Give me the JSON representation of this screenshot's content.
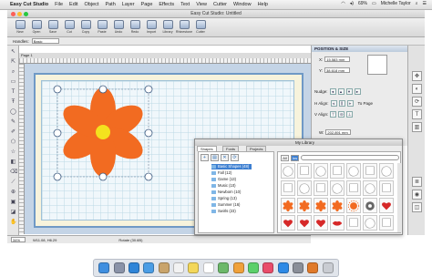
{
  "menubar": {
    "app_name": "Easy Cut Studio",
    "menus": [
      "File",
      "Edit",
      "Object",
      "Path",
      "Layer",
      "Page",
      "Effects",
      "Text",
      "View",
      "Cutter",
      "Window",
      "Help"
    ],
    "battery": "69%",
    "user": "Michelle Taylor"
  },
  "window": {
    "title": "Easy Cut Studio: Untitled"
  },
  "toolbar": {
    "buttons": [
      "New",
      "Open",
      "Save",
      "Cut",
      "Copy",
      "Paste",
      "Undo",
      "Redo",
      "Import",
      "Library",
      "Rhinestone",
      "Cutter"
    ]
  },
  "handles": {
    "label": "Handles:",
    "value": "Basic"
  },
  "canvas": {
    "page_label": "Page 1"
  },
  "flower": {
    "petal_color": "#f26b21",
    "center_color": "#f4e21e"
  },
  "status": {
    "zoom": "34%",
    "coords": "W11.08, H6.29",
    "hint": "Rotate (30.6B)"
  },
  "position_panel": {
    "title": "POSITION & SIZE",
    "x_value": "15.583 mm",
    "y_value": "38.618 mm",
    "nudge_label": "Nudge:",
    "h_align_label": "H Align:",
    "v_align_label": "V Align:",
    "to_page_label": "To Page",
    "w_value": "202.891 mm"
  },
  "library": {
    "title": "My Library",
    "tabs": [
      "Shapes",
      "Fonts",
      "Projects"
    ],
    "folders": [
      {
        "name": "Basic Shapes (48)",
        "selected": true
      },
      {
        "name": "Fall (12)",
        "selected": false
      },
      {
        "name": "Game (13)",
        "selected": false
      },
      {
        "name": "Music (10)",
        "selected": false
      },
      {
        "name": "Newborn (10)",
        "selected": false
      },
      {
        "name": "Spring (13)",
        "selected": false
      },
      {
        "name": "Summer (16)",
        "selected": false
      },
      {
        "name": "Swirls (23)",
        "selected": false
      }
    ],
    "search_buttons": [
      "All",
      "Ins"
    ],
    "shapes": [
      "shape",
      "shape",
      "shape",
      "shape",
      "shape",
      "shape",
      "shape",
      "shape",
      "shape",
      "shape",
      "shape",
      "shape",
      "shape",
      "shape",
      "flower",
      "flower",
      "flower",
      "flower",
      "sun",
      "gear",
      "heart",
      "heart",
      "heart",
      "heart",
      "lips",
      "shape",
      "shape",
      "shape"
    ]
  },
  "dock": {
    "apps": [
      "Finder",
      "Launchpad",
      "Safari",
      "Mail",
      "Contacts",
      "Calendar",
      "Notes",
      "Reminders",
      "Maps",
      "Photos",
      "Messages",
      "Music",
      "App Store",
      "System Preferences",
      "Easy Cut Studio",
      "Trash"
    ],
    "colors": [
      "#3f8fe0",
      "#8a93a8",
      "#2f85d8",
      "#4a9de5",
      "#c9a46b",
      "#f2f2f2",
      "#f3d75a",
      "#ffffff",
      "#6cb86a",
      "#f0a13b",
      "#5bd06b",
      "#e94c6a",
      "#2e8ae6",
      "#8a8f99",
      "#e07a2a",
      "#c9ccd2"
    ]
  }
}
